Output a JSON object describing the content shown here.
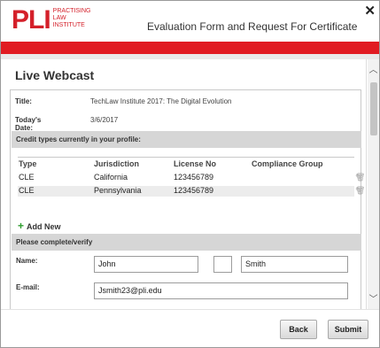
{
  "header": {
    "logo_text": "PLI",
    "logo_sub": [
      "Practising",
      "Law",
      "Institute"
    ],
    "title": "Evaluation Form and Request For Certificate",
    "close_icon": "close-icon",
    "brand_color": "#e11b22"
  },
  "section": {
    "title": "Live Webcast"
  },
  "event": {
    "title_label": "Title:",
    "title_value": "TechLaw Institute 2017: The Digital Evolution",
    "date_label": "Today's Date:",
    "date_value": "3/6/2017"
  },
  "credit": {
    "band_label": "Credit types currently in your profile:",
    "columns": [
      "Type",
      "Jurisdiction",
      "License No",
      "Compliance Group"
    ],
    "rows": [
      {
        "type": "CLE",
        "jurisdiction": "California",
        "license": "123456789",
        "group": ""
      },
      {
        "type": "CLE",
        "jurisdiction": "Pennsylvania",
        "license": "123456789",
        "group": ""
      }
    ],
    "row_icons": [
      "pencil-icon",
      "trash-icon"
    ],
    "add_new_label": "Add New"
  },
  "form": {
    "band_label": "Please complete/verify",
    "name_label": "Name:",
    "first_name": "John",
    "middle_initial": "",
    "last_name": "Smith",
    "email_label": "E-mail:",
    "email": "Jsmith23@pli.edu"
  },
  "footer": {
    "back_label": "Back",
    "submit_label": "Submit"
  }
}
